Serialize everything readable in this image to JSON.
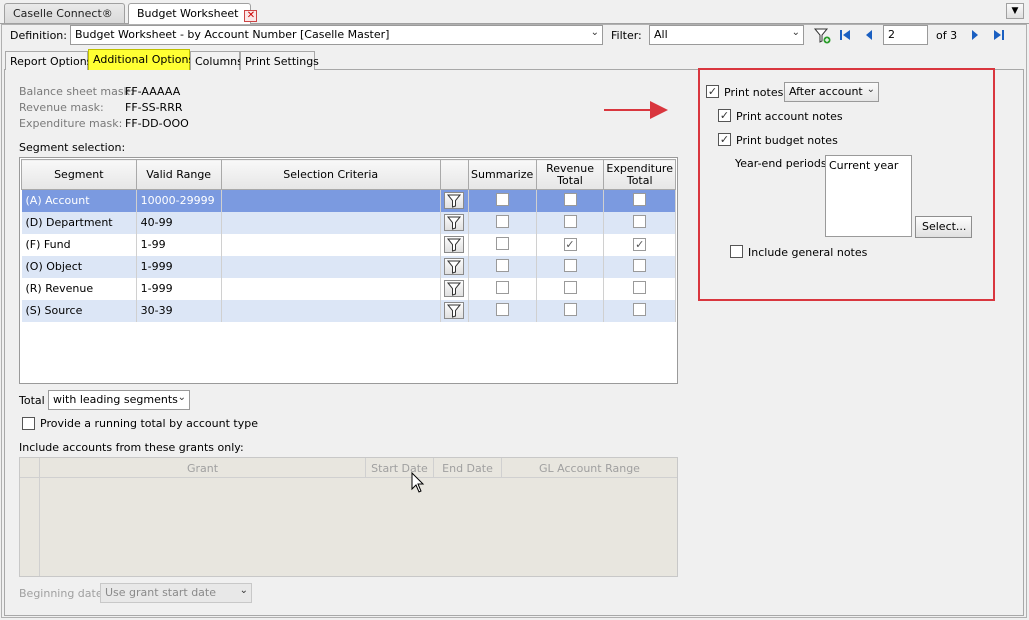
{
  "tabs": [
    {
      "label": "Caselle Connect®"
    },
    {
      "label": "Budget Worksheet",
      "close_icon": "close-icon"
    }
  ],
  "toolbar": {
    "definition_label": "Definition:",
    "definition_value": "Budget Worksheet - by Account Number [Caselle Master]",
    "filter_label": "Filter:",
    "filter_value": "All",
    "page_value": "2",
    "page_total": "of 3",
    "icons": [
      "filter-add-icon",
      "first-page-icon",
      "prev-page-icon",
      "next-page-icon",
      "last-page-icon"
    ]
  },
  "subtabs": [
    "Report Options",
    "Additional Options",
    "Columns",
    "Print Settings"
  ],
  "masks": [
    {
      "label": "Balance sheet mask:",
      "value": "FF-AAAAA"
    },
    {
      "label": "Revenue mask:",
      "value": "FF-SS-RRR"
    },
    {
      "label": "Expenditure mask:",
      "value": "FF-DD-OOO"
    }
  ],
  "segment_selection": {
    "label": "Segment selection:",
    "headers": [
      "Segment",
      "Valid Range",
      "Selection Criteria",
      "",
      "Summarize",
      "Revenue Total",
      "Expenditure Total"
    ],
    "rows": [
      {
        "segment": "(A) Account",
        "range": "10000-29999",
        "criteria": "",
        "summarize": false,
        "revenue": false,
        "expenditure": false
      },
      {
        "segment": "(D) Department",
        "range": "40-99",
        "criteria": "",
        "summarize": false,
        "revenue": false,
        "expenditure": false
      },
      {
        "segment": "(F) Fund",
        "range": "1-99",
        "criteria": "",
        "summarize": false,
        "revenue": true,
        "expenditure": true
      },
      {
        "segment": "(O) Object",
        "range": "1-999",
        "criteria": "",
        "summarize": false,
        "revenue": false,
        "expenditure": false
      },
      {
        "segment": "(R) Revenue",
        "range": "1-999",
        "criteria": "",
        "summarize": false,
        "revenue": false,
        "expenditure": false
      },
      {
        "segment": "(S) Source",
        "range": "30-39",
        "criteria": "",
        "summarize": false,
        "revenue": false,
        "expenditure": false
      }
    ]
  },
  "total": {
    "label": "Total",
    "value": "with leading segments"
  },
  "running_total": {
    "label": "Provide a running total by account type",
    "checked": false
  },
  "grants": {
    "label": "Include accounts from these grants only:",
    "headers": [
      "Grant",
      "Start Date",
      "End Date",
      "GL Account Range"
    ]
  },
  "beginning_date": {
    "label": "Beginning date:",
    "value": "Use grant start date"
  },
  "print_notes": {
    "label": "Print notes",
    "checked": true,
    "position": "After account",
    "account_notes": {
      "label": "Print account notes",
      "checked": true
    },
    "budget_notes": {
      "label": "Print budget notes",
      "checked": true
    },
    "year_end_label": "Year-end periods:",
    "year_end_value": "Current year",
    "select_button": "Select...",
    "general_notes": {
      "label": "Include general notes",
      "checked": false
    }
  },
  "colors": {
    "highlight_box": "#d9363e",
    "arrow": "#d9363e",
    "selected_row": "#7b9ae0",
    "alt_row": "#dce6f6",
    "active_subtab": "#ffff33"
  }
}
